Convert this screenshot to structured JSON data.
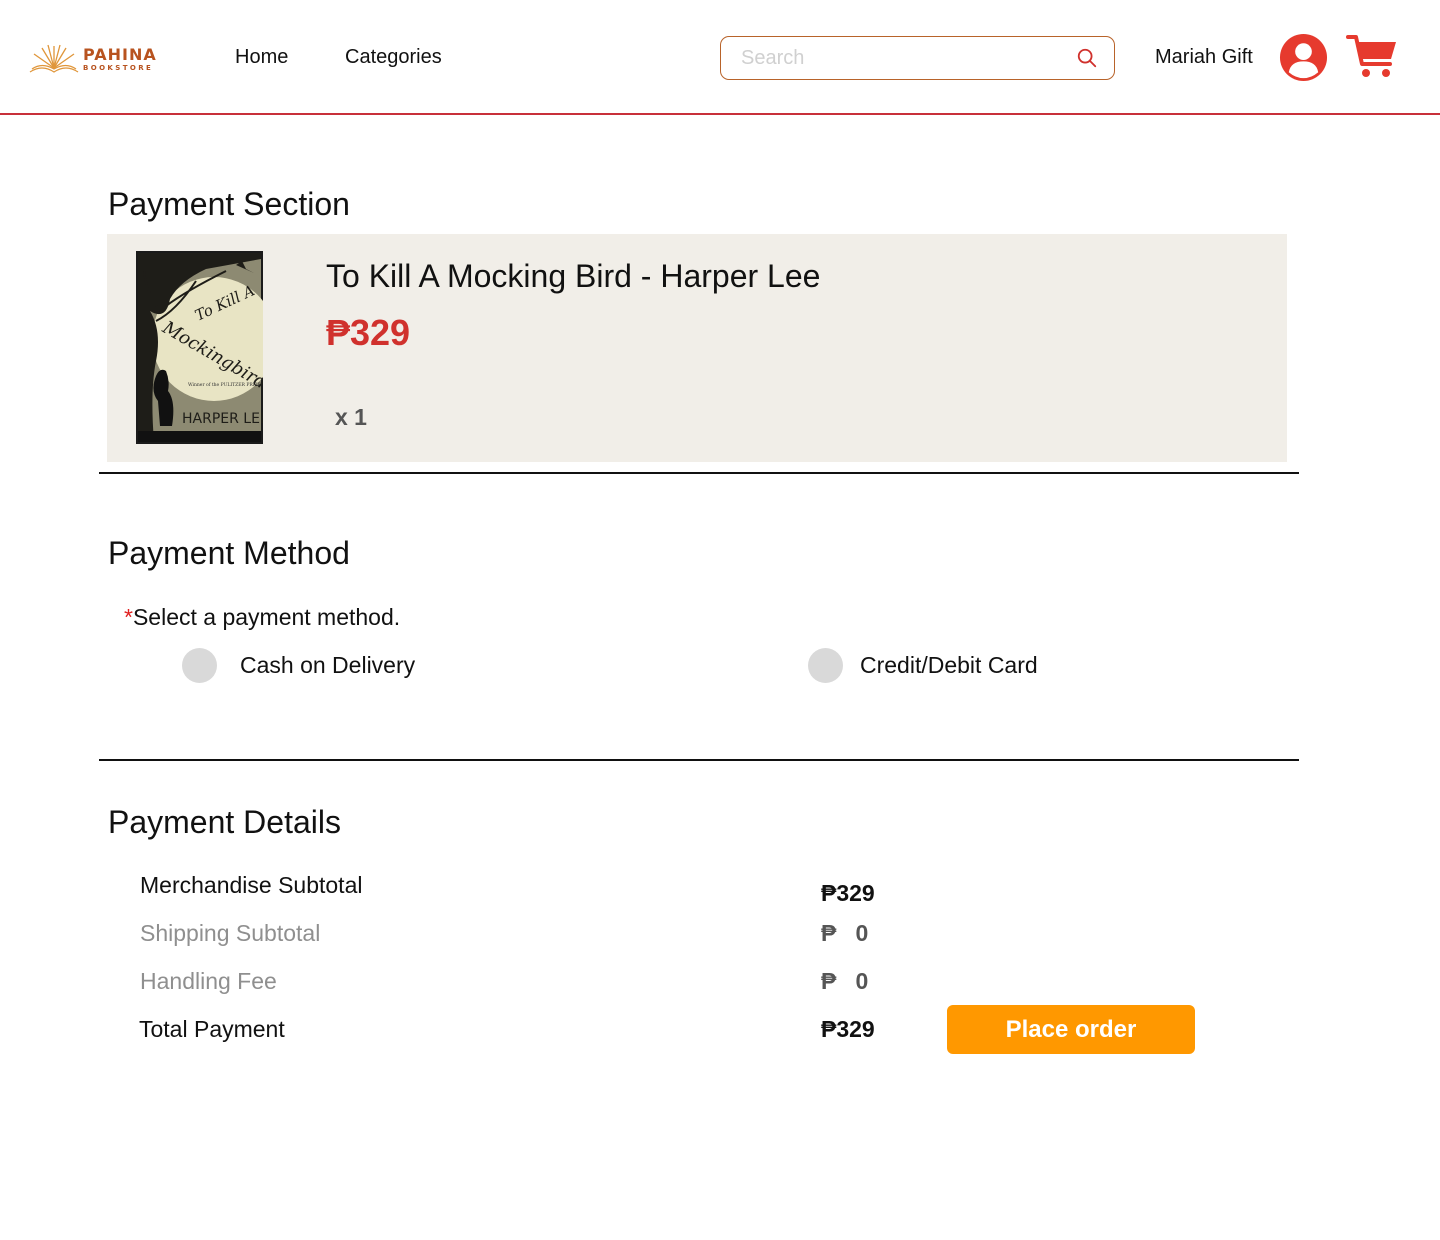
{
  "header": {
    "logo": {
      "name": "PAHINA",
      "subtitle": "BOOKSTORE"
    },
    "nav": {
      "home": "Home",
      "categories": "Categories"
    },
    "search": {
      "placeholder": "Search",
      "value": ""
    },
    "user": {
      "name": "Mariah Gift"
    },
    "icons": {
      "search": "search-icon",
      "avatar": "user-avatar-icon",
      "cart": "cart-icon"
    }
  },
  "payment_section": {
    "title": "Payment Section",
    "product": {
      "title": "To Kill A Mocking Bird - Harper Lee",
      "price": "₱329",
      "quantity": "x 1",
      "cover": {
        "title_line_1": "To Kill A",
        "title_line_2": "Mockingbird",
        "award": "Winner of the PULITZER PRIZE",
        "author": "HARPER LEE"
      }
    }
  },
  "payment_method": {
    "title": "Payment Method",
    "required_marker": "*",
    "prompt": "Select a payment method.",
    "options": [
      {
        "label": "Cash on Delivery",
        "selected": false
      },
      {
        "label": "Credit/Debit Card",
        "selected": false
      }
    ]
  },
  "payment_details": {
    "title": "Payment Details",
    "rows": [
      {
        "label": "Merchandise Subtotal",
        "value": "₱329"
      },
      {
        "label": "Shipping Subtotal",
        "value": "₱   0"
      },
      {
        "label": "Handling Fee",
        "value": "₱   0"
      },
      {
        "label": "Total Payment",
        "value": "₱329"
      }
    ],
    "place_order_label": "Place order"
  },
  "colors": {
    "accent_red": "#d0312d",
    "header_border": "#c8303a",
    "button_orange": "#ff9800",
    "card_bg": "#f1eee8",
    "brand_brown": "#b8531f"
  }
}
